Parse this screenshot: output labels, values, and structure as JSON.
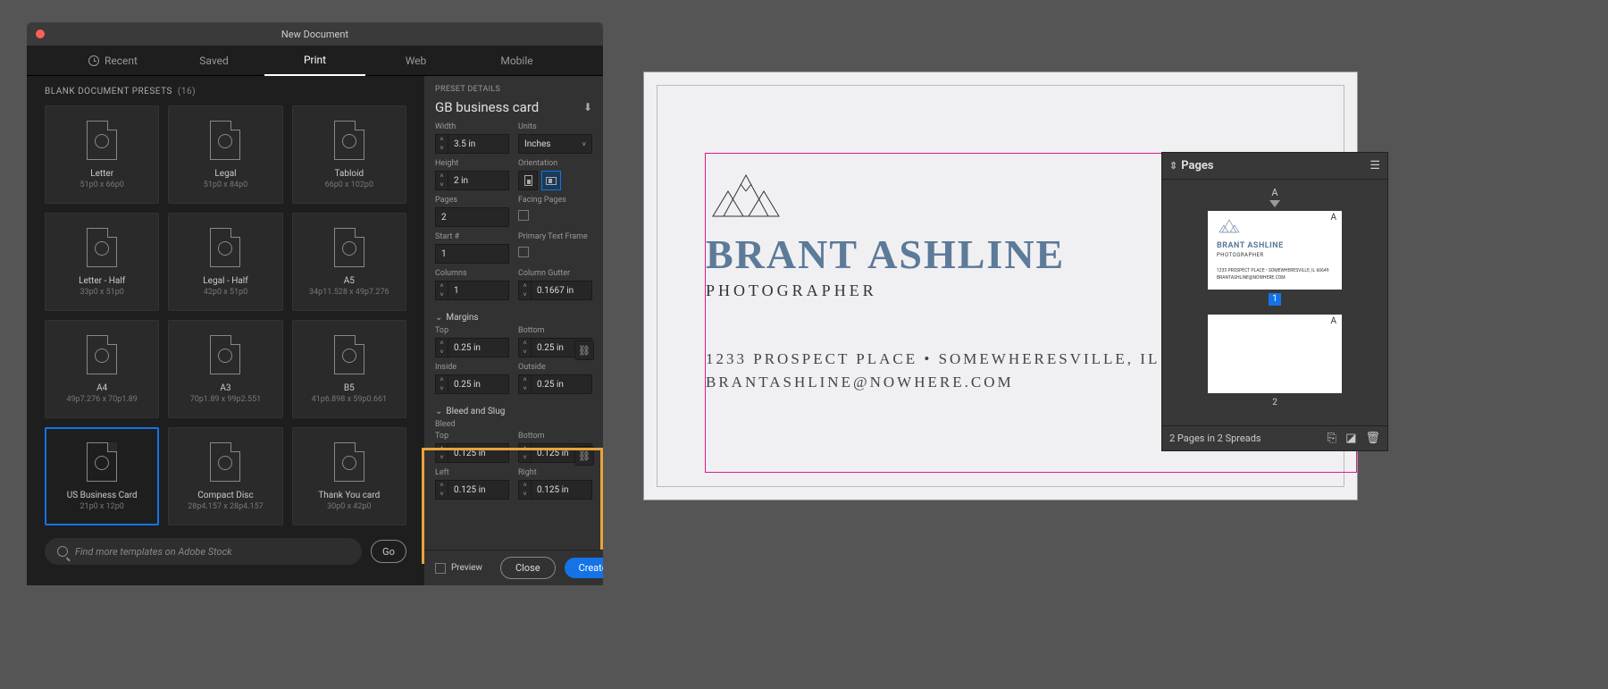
{
  "dialog": {
    "title": "New Document",
    "tabs": {
      "recent": "Recent",
      "saved": "Saved",
      "print": "Print",
      "web": "Web",
      "mobile": "Mobile"
    },
    "presets_header": "BLANK DOCUMENT PRESETS",
    "presets_count": "(16)",
    "presets": [
      {
        "name": "Letter",
        "dim": "51p0 x 66p0"
      },
      {
        "name": "Legal",
        "dim": "51p0 x 84p0"
      },
      {
        "name": "Tabloid",
        "dim": "66p0 x 102p0"
      },
      {
        "name": "Letter - Half",
        "dim": "33p0 x 51p0"
      },
      {
        "name": "Legal - Half",
        "dim": "42p0 x 51p0"
      },
      {
        "name": "A5",
        "dim": "34p11.528 x 49p7.276"
      },
      {
        "name": "A4",
        "dim": "49p7.276 x 70p1.89"
      },
      {
        "name": "A3",
        "dim": "70p1.89 x 99p2.551"
      },
      {
        "name": "B5",
        "dim": "41p6.898 x 59p0.661"
      },
      {
        "name": "US Business Card",
        "dim": "21p0 x 12p0"
      },
      {
        "name": "Compact Disc",
        "dim": "28p4.157 x 28p4.157"
      },
      {
        "name": "Thank You card",
        "dim": "30p0 x 42p0"
      }
    ],
    "search_placeholder": "Find more templates on Adobe Stock",
    "go_label": "Go",
    "preview_label": "Preview",
    "close_label": "Close",
    "create_label": "Create"
  },
  "details": {
    "section": "PRESET DETAILS",
    "doc_name": "GB business card",
    "width_label": "Width",
    "width_val": "3.5 in",
    "units_label": "Units",
    "units_val": "Inches",
    "height_label": "Height",
    "height_val": "2 in",
    "orientation_label": "Orientation",
    "pages_label": "Pages",
    "pages_val": "2",
    "facing_label": "Facing Pages",
    "start_label": "Start #",
    "start_val": "1",
    "ptf_label": "Primary Text Frame",
    "columns_label": "Columns",
    "columns_val": "1",
    "gutter_label": "Column Gutter",
    "gutter_val": "0.1667 in",
    "margins_header": "Margins",
    "top_label": "Top",
    "bottom_label": "Bottom",
    "inside_label": "Inside",
    "outside_label": "Outside",
    "margin_val": "0.25 in",
    "bleed_header": "Bleed and Slug",
    "bleed_label": "Bleed",
    "left_label": "Left",
    "right_label": "Right",
    "bleed_val": "0.125 in"
  },
  "card": {
    "name": "BRANT ASHLINE",
    "role": "PHOTOGRAPHER",
    "address": "1233 PROSPECT PLACE  •  SOMEWHERESVILLE, IL",
    "email": "BRANTASHLINE@NOWHERE.COM",
    "thumb_addr": "1233 PROSPECT PLACE  •  SOMEWHERESVILLE, IL 60649"
  },
  "pages_panel": {
    "title": "Pages",
    "master_a": "A",
    "page1": "1",
    "page2": "2",
    "footer": "2 Pages in 2 Spreads"
  }
}
